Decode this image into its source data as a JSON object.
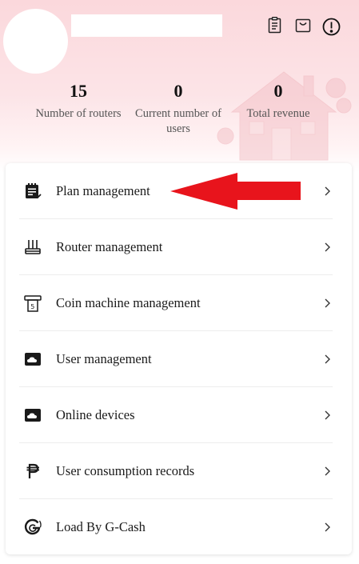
{
  "header": {
    "username": "",
    "icons": [
      "clipboard-icon",
      "shopping-bag-icon",
      "alert-icon"
    ]
  },
  "stats": [
    {
      "value": "15",
      "label": "Number of routers"
    },
    {
      "value": "0",
      "label": "Current number of users"
    },
    {
      "value": "0",
      "label": "Total revenue"
    }
  ],
  "menu": [
    {
      "label": "Plan management",
      "icon": "plan-calendar-icon"
    },
    {
      "label": "Router management",
      "icon": "router-icon"
    },
    {
      "label": "Coin machine management",
      "icon": "coin-machine-icon"
    },
    {
      "label": "User management",
      "icon": "user-cloud-icon"
    },
    {
      "label": "Online devices",
      "icon": "online-cloud-icon"
    },
    {
      "label": "User consumption records",
      "icon": "peso-icon"
    },
    {
      "label": "Load By G-Cash",
      "icon": "gcash-icon"
    }
  ],
  "colors": {
    "header_bg": "#fbd8dc",
    "annotation_arrow": "#e8141c"
  }
}
